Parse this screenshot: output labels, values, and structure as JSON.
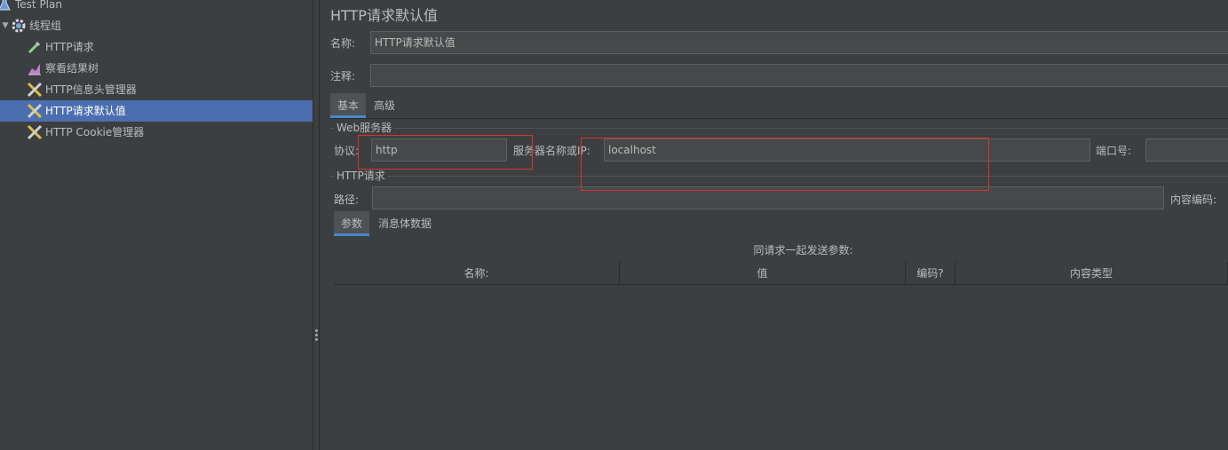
{
  "tree": {
    "items": [
      {
        "label": "Test Plan",
        "icon": "test-plan-icon"
      },
      {
        "label": "线程组",
        "icon": "gear-icon"
      },
      {
        "label": "HTTP请求",
        "icon": "pipette-icon"
      },
      {
        "label": "察看结果树",
        "icon": "chart-icon"
      },
      {
        "label": "HTTP信息头管理器",
        "icon": "tools-icon"
      },
      {
        "label": "HTTP请求默认值",
        "icon": "tools-icon"
      },
      {
        "label": "HTTP Cookie管理器",
        "icon": "tools-icon"
      }
    ]
  },
  "panel": {
    "title": "HTTP请求默认值",
    "name_label": "名称:",
    "name_value": "HTTP请求默认值",
    "comment_label": "注释:",
    "comment_value": "",
    "tabs": [
      "基本",
      "高级"
    ],
    "web_server_group": "Web服务器",
    "protocol_label": "协议:",
    "protocol_value": "http",
    "server_label": "服务器名称或IP:",
    "server_value": "localhost",
    "port_label": "端口号:",
    "port_value": "",
    "http_request_group": "HTTP请求",
    "path_label": "路径:",
    "path_value": "",
    "encoding_label": "内容编码:",
    "subtabs": [
      "参数",
      "消息体数据"
    ],
    "params_caption": "同请求一起发送参数:",
    "columns": [
      "名称:",
      "值",
      "编码?",
      "内容类型"
    ]
  },
  "colors": {
    "background": "#3c3f41",
    "selection": "#4b6eaf",
    "highlight_box": "#e03030"
  }
}
